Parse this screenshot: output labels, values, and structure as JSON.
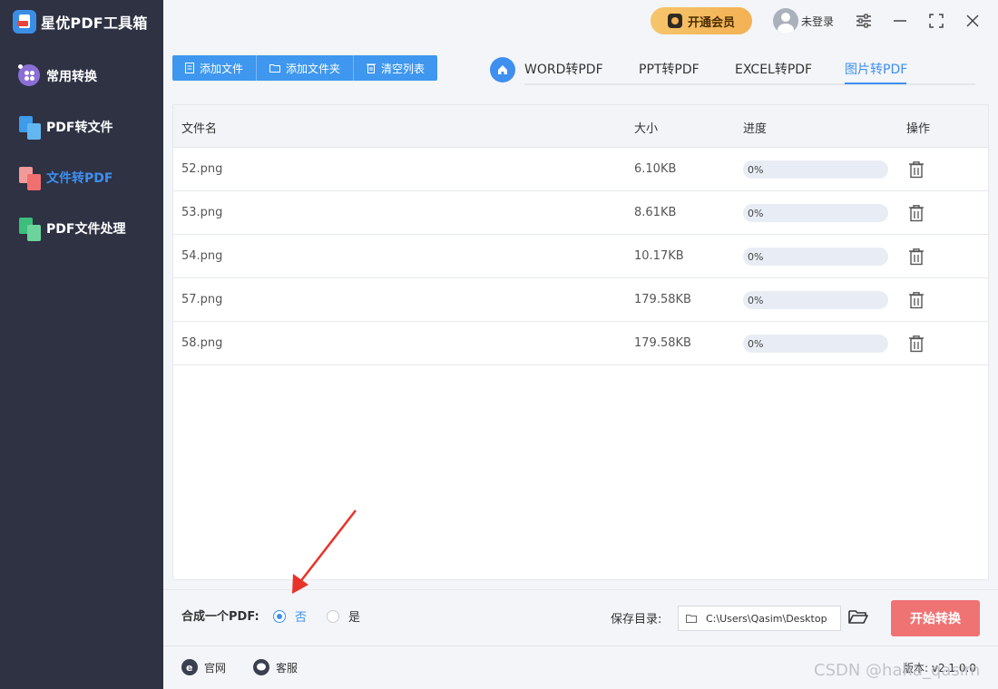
{
  "app": {
    "title": "星优PDF工具箱"
  },
  "sidebar": {
    "items": [
      {
        "label": "常用转换",
        "icon": "grid-icon",
        "active": false
      },
      {
        "label": "PDF转文件",
        "icon": "pdf-to-file-icon",
        "active": false
      },
      {
        "label": "文件转PDF",
        "icon": "file-to-pdf-icon",
        "active": true
      },
      {
        "label": "PDF文件处理",
        "icon": "pdf-process-icon",
        "active": false
      }
    ]
  },
  "header": {
    "vip_label": "开通会员",
    "user_label": "未登录"
  },
  "toolbar": {
    "add_file": "添加文件",
    "add_folder": "添加文件夹",
    "clear_list": "清空列表"
  },
  "tabs": [
    {
      "label": "WORD转PDF",
      "active": false
    },
    {
      "label": "PPT转PDF",
      "active": false
    },
    {
      "label": "EXCEL转PDF",
      "active": false
    },
    {
      "label": "图片转PDF",
      "active": true
    }
  ],
  "table": {
    "columns": [
      "文件名",
      "大小",
      "进度",
      "操作"
    ],
    "rows": [
      {
        "name": "52.png",
        "size": "6.10KB",
        "progress": "0%",
        "progress_value": 0
      },
      {
        "name": "53.png",
        "size": "8.61KB",
        "progress": "0%",
        "progress_value": 0
      },
      {
        "name": "54.png",
        "size": "10.17KB",
        "progress": "0%",
        "progress_value": 0
      },
      {
        "name": "57.png",
        "size": "179.58KB",
        "progress": "0%",
        "progress_value": 0
      },
      {
        "name": "58.png",
        "size": "179.58KB",
        "progress": "0%",
        "progress_value": 0
      }
    ]
  },
  "options": {
    "merge_label": "合成一个PDF:",
    "no_label": "否",
    "yes_label": "是",
    "merge_selected": "否"
  },
  "save": {
    "label": "保存目录:",
    "path": "C:\\Users\\Qasim\\Desktop"
  },
  "start_label": "开始转换",
  "footer": {
    "website": "官网",
    "support": "客服",
    "version": "版本: v2.1.0.0"
  },
  "watermark": "CSDN @haha_qasim",
  "colors": {
    "sidebar_bg": "#2e3243",
    "accent": "#3e8ff0",
    "start_button": "#f07374",
    "vip": "#f3b154",
    "annotation_arrow": "#e8332a"
  }
}
